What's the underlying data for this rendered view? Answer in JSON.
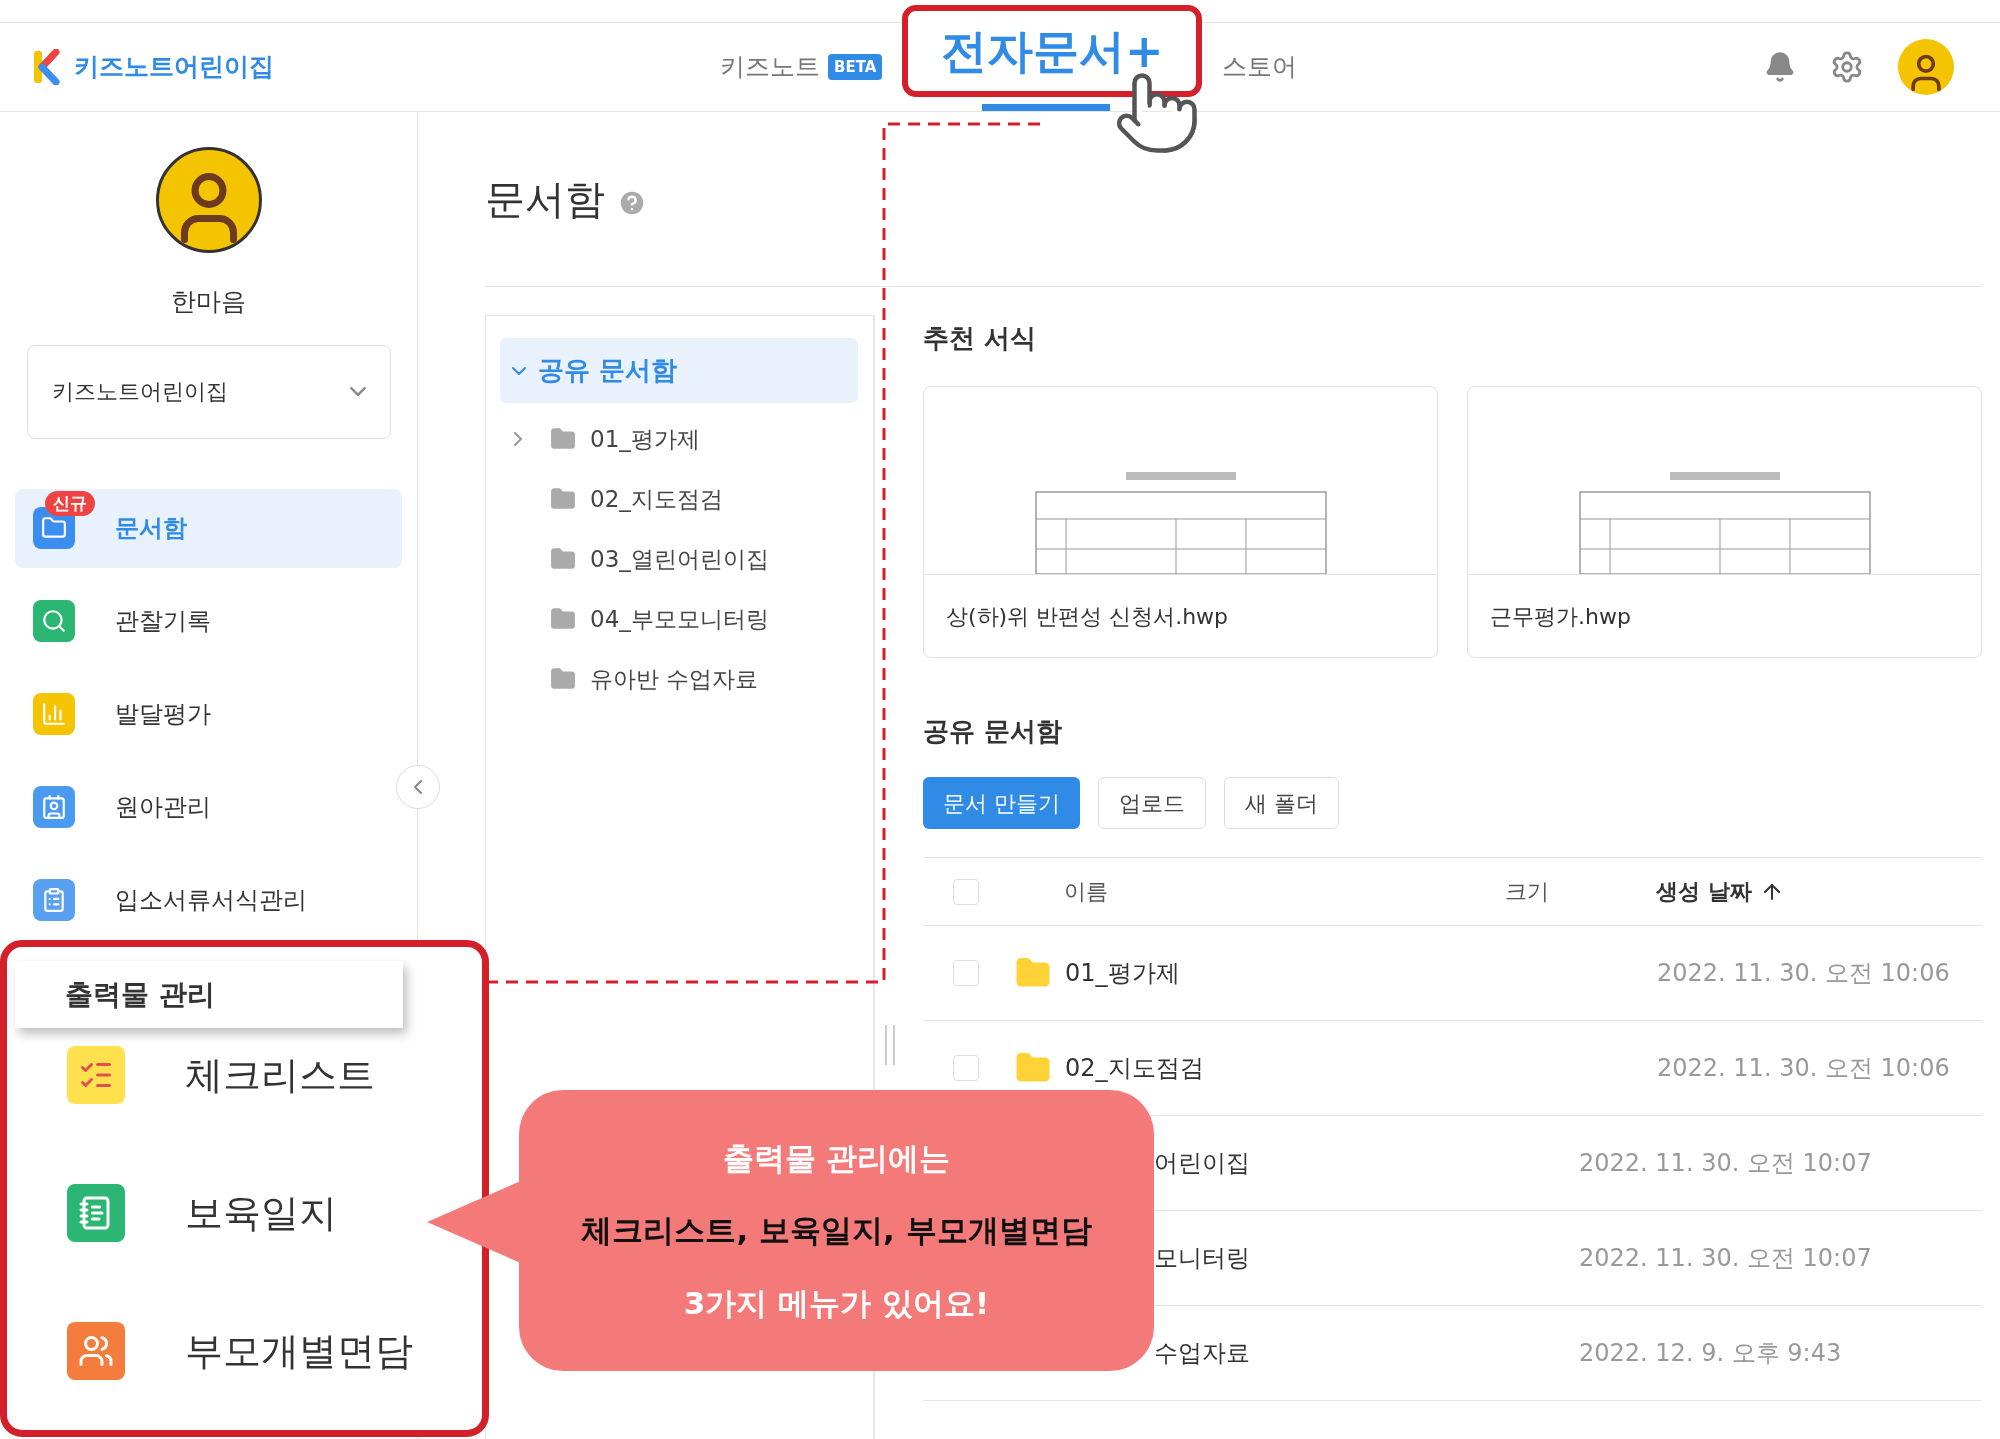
{
  "app": {
    "name": "키즈노트어린이집"
  },
  "nav": [
    {
      "label": "키즈노트",
      "badge": "BETA",
      "selected": false,
      "highlighted": false
    },
    {
      "label": "전자문서+",
      "selected": true,
      "highlighted": true
    },
    {
      "label": "스토어",
      "selected": false,
      "highlighted": false
    }
  ],
  "profile": {
    "name": "한마음"
  },
  "center_select": {
    "value": "키즈노트어린이집"
  },
  "menu": [
    {
      "label": "문서함",
      "badge": "신규",
      "selected": true
    },
    {
      "label": "관찰기록",
      "selected": false
    },
    {
      "label": "발달평가",
      "selected": false
    },
    {
      "label": "원아관리",
      "selected": false
    },
    {
      "label": "입소서류서식관리",
      "selected": false
    }
  ],
  "page_title": "문서함",
  "tree": {
    "label": "공유 문서함",
    "expanded": true,
    "selected": true,
    "children": [
      {
        "label": "01_평가제",
        "expandable": true
      },
      {
        "label": "02_지도점검",
        "expandable": false
      },
      {
        "label": "03_열린어린이집",
        "expandable": false
      },
      {
        "label": "04_부모모니터링",
        "expandable": false
      },
      {
        "label": "유아반 수업자료",
        "expandable": false
      }
    ]
  },
  "recommended": {
    "title": "추천 서식",
    "templates": [
      {
        "name": "상(하)위 반편성 신청서.hwp"
      },
      {
        "name": "근무평가.hwp"
      }
    ]
  },
  "shared": {
    "title": "공유 문서함",
    "buttons": [
      {
        "label": "문서 만들기",
        "primary": true
      },
      {
        "label": "업로드",
        "primary": false
      },
      {
        "label": "새 폴더",
        "primary": false
      }
    ],
    "columns": [
      {
        "label": "이름",
        "sorted": false
      },
      {
        "label": "크기",
        "sorted": false
      },
      {
        "label": "생성 날짜",
        "sorted": true
      }
    ],
    "select_all": {
      "checked": false
    },
    "rows": [
      {
        "name": "01_평가제",
        "date": "2022. 11. 30. 오전 10:06",
        "checked": false,
        "covered": false
      },
      {
        "name": "02_지도점검",
        "date": "2022. 11. 30. 오전 10:06",
        "checked": false,
        "covered": false
      },
      {
        "name": "어린이집",
        "date": "2022. 11. 30. 오전 10:07",
        "covered": true
      },
      {
        "name": "모니터링",
        "date": "2022. 11. 30. 오전 10:07",
        "covered": true
      },
      {
        "name": "수업자료",
        "date": "2022. 12. 9. 오후 9:43",
        "covered": true
      }
    ]
  },
  "output_menu": {
    "title": "출력물 관리",
    "items": [
      {
        "label": "체크리스트"
      },
      {
        "label": "보육일지"
      },
      {
        "label": "부모개별면담"
      }
    ]
  },
  "callout": {
    "lines": [
      {
        "text": "출력물 관리에는",
        "emphasis": false
      },
      {
        "text": "체크리스트, 보육일지, 부모개별면담",
        "emphasis": true
      },
      {
        "text": "3가지 메뉴가 있어요!",
        "emphasis": false
      }
    ]
  }
}
